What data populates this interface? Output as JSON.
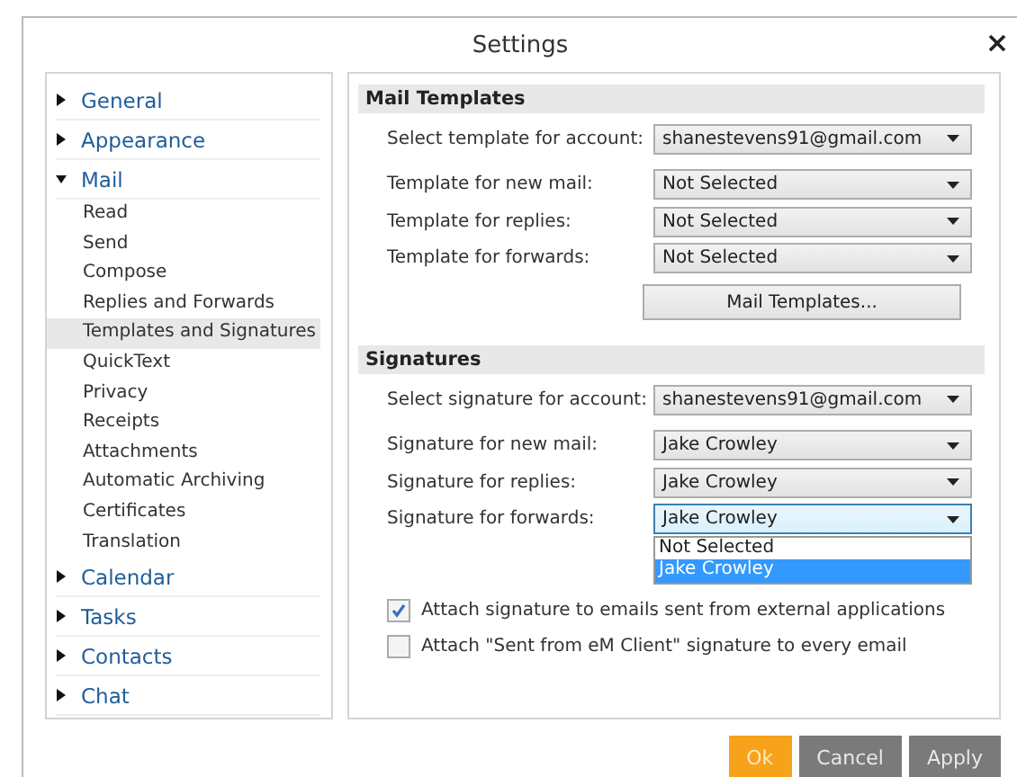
{
  "window": {
    "title": "Settings"
  },
  "sidebar": {
    "items": [
      {
        "label": "General",
        "expanded": false,
        "selected": false
      },
      {
        "label": "Appearance",
        "expanded": false,
        "selected": false
      },
      {
        "label": "Mail",
        "expanded": true,
        "selected": false,
        "children": [
          {
            "label": "Read",
            "selected": false
          },
          {
            "label": "Send",
            "selected": false
          },
          {
            "label": "Compose",
            "selected": false
          },
          {
            "label": "Replies and Forwards",
            "selected": false
          },
          {
            "label": "Templates and Signatures",
            "selected": true
          },
          {
            "label": "QuickText",
            "selected": false
          },
          {
            "label": "Privacy",
            "selected": false
          },
          {
            "label": "Receipts",
            "selected": false
          },
          {
            "label": "Attachments",
            "selected": false
          },
          {
            "label": "Automatic Archiving",
            "selected": false
          },
          {
            "label": "Certificates",
            "selected": false
          },
          {
            "label": "Translation",
            "selected": false
          }
        ]
      },
      {
        "label": "Calendar",
        "expanded": false,
        "selected": false
      },
      {
        "label": "Tasks",
        "expanded": false,
        "selected": false
      },
      {
        "label": "Contacts",
        "expanded": false,
        "selected": false
      },
      {
        "label": "Chat",
        "expanded": false,
        "selected": false
      }
    ]
  },
  "sections": [
    {
      "title": "Mail Templates",
      "rows": [
        {
          "label": "Select template for account:",
          "value": "shanestevens91@gmail.com",
          "open": false
        },
        {
          "label": "Template for new mail:",
          "value": "Not Selected",
          "open": false
        },
        {
          "label": "Template for replies:",
          "value": "Not Selected",
          "open": false
        },
        {
          "label": "Template for forwards:",
          "value": "Not Selected",
          "open": false
        }
      ],
      "button": "Mail Templates..."
    },
    {
      "title": "Signatures",
      "rows": [
        {
          "label": "Select signature for account:",
          "value": "shanestevens91@gmail.com",
          "open": false
        },
        {
          "label": "Signature for new mail:",
          "value": "Jake Crowley",
          "open": false
        },
        {
          "label": "Signature for replies:",
          "value": "Jake Crowley",
          "open": false
        },
        {
          "label": "Signature for forwards:",
          "value": "Jake Crowley",
          "open": true,
          "options": [
            {
              "label": "Not Selected",
              "selected": false
            },
            {
              "label": "Jake Crowley",
              "selected": true
            }
          ]
        }
      ],
      "checkboxes": [
        {
          "label": "Attach signature to emails sent from external applications",
          "checked": true
        },
        {
          "label": "Attach \"Sent from eM Client\" signature to every email",
          "checked": false
        }
      ]
    }
  ],
  "buttons": [
    {
      "label": "Ok",
      "kind": "primary"
    },
    {
      "label": "Cancel",
      "kind": "secondary"
    },
    {
      "label": "Apply",
      "kind": "secondary"
    }
  ]
}
